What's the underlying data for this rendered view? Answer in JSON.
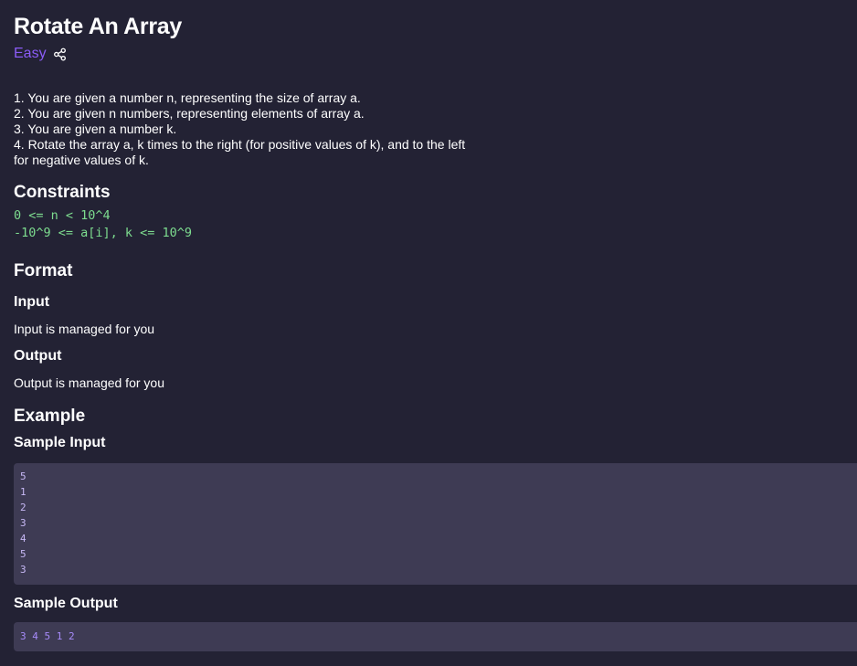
{
  "problem": {
    "title": "Rotate An Array",
    "difficulty": "Easy",
    "difficulty_color": "#8b5cf6",
    "share_icon": "share-icon"
  },
  "description": {
    "lines": [
      "1. You are given a number n, representing the size of array a.",
      "2. You are given n numbers, representing elements of array a.",
      "3. You are given a number k.",
      "4. Rotate the array a, k times to the right (for positive values of k), and to the left for negative values of k."
    ]
  },
  "constraints": {
    "heading": "Constraints",
    "lines": [
      "0 <= n < 10^4",
      "-10^9 <= a[i], k <= 10^9"
    ]
  },
  "format": {
    "heading": "Format",
    "input_heading": "Input",
    "input_text": "Input is managed for you",
    "output_heading": "Output",
    "output_text": "Output is managed for you"
  },
  "example": {
    "heading": "Example",
    "sample_input_heading": "Sample Input",
    "sample_input_lines": [
      "5",
      "1",
      "2",
      "3",
      "4",
      "5",
      "3"
    ],
    "sample_output_heading": "Sample Output",
    "sample_output": "3 4 5 1 2"
  }
}
